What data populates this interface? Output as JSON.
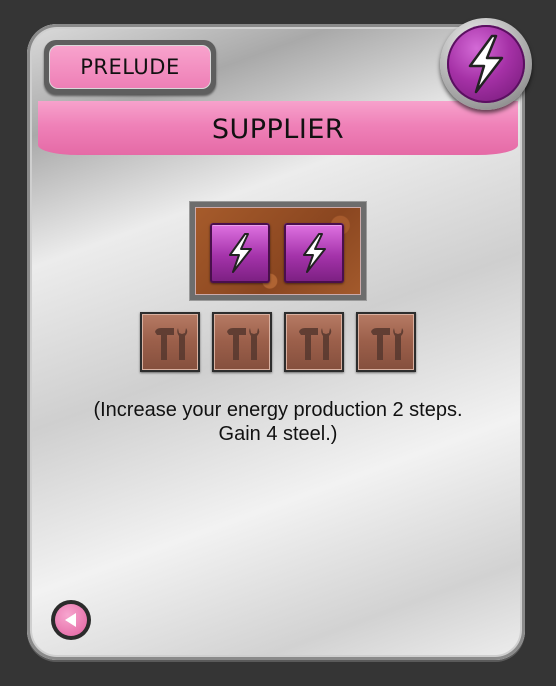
{
  "card": {
    "type_tag": "PRELUDE",
    "title": "SUPPLIER",
    "tag_icon": "energy-icon",
    "description_lines": [
      "(Increase your energy production 2 steps.",
      "Gain 4 steel.)"
    ]
  },
  "effects": {
    "production": {
      "resource": "energy",
      "icon": "energy-icon",
      "count": 2
    },
    "gain": {
      "resource": "steel",
      "icon": "steel-icon",
      "count": 4
    }
  },
  "controls": {
    "back_icon": "back-arrow-icon"
  },
  "colors": {
    "accent_pink": "#ef81b8",
    "energy_purple": "#a433aa",
    "steel_brown": "#9b5f4a"
  }
}
